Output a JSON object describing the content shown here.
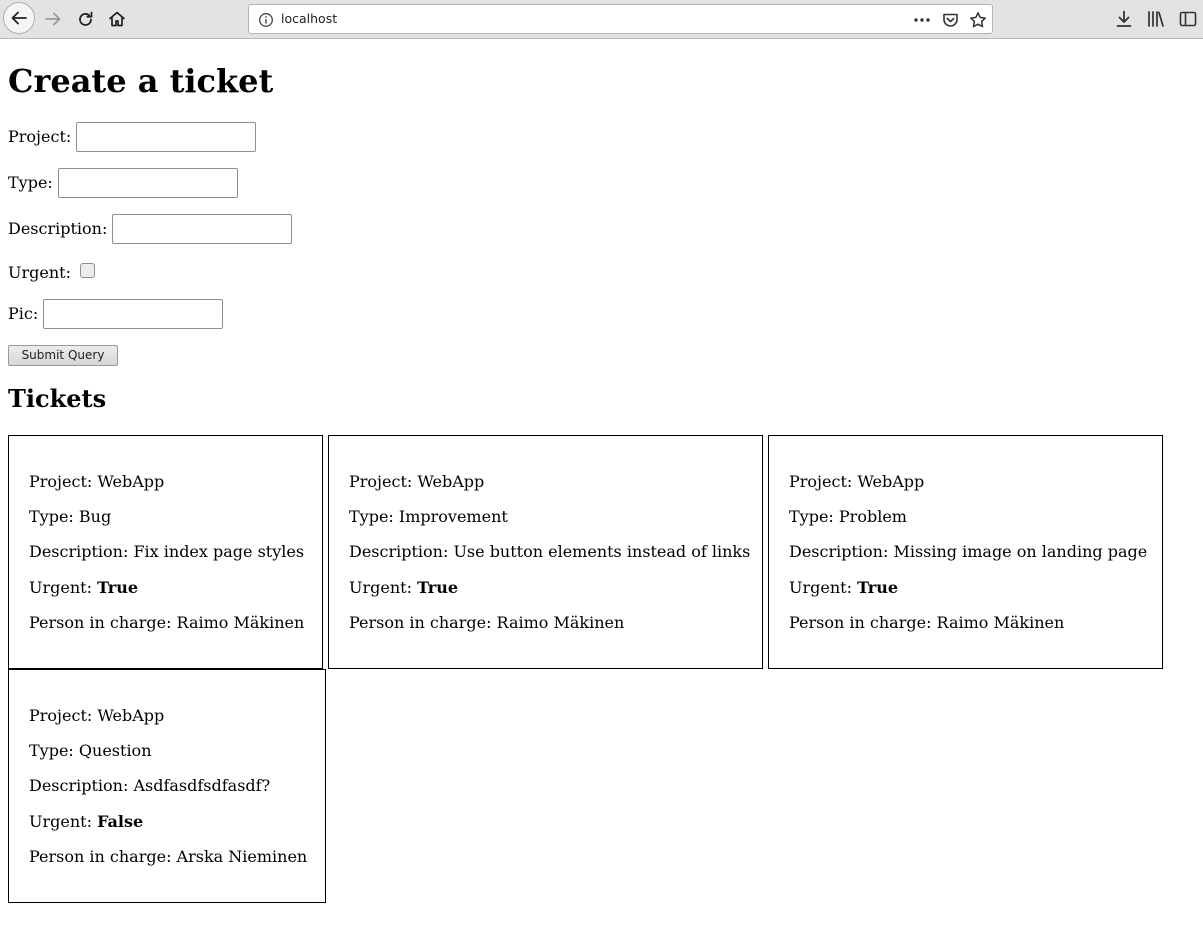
{
  "browser": {
    "url": "localhost",
    "buttons": {
      "back": "back-arrow-icon",
      "forward": "forward-arrow-icon",
      "reload": "reload-icon",
      "home": "home-icon",
      "page_actions": "more-icon",
      "pocket": "pocket-icon",
      "bookmark": "star-icon",
      "downloads": "download-icon",
      "library": "library-icon",
      "sidebar": "sidebar-icon"
    }
  },
  "form": {
    "title": "Create a ticket",
    "fields": {
      "project": {
        "label": "Project:",
        "value": ""
      },
      "type": {
        "label": "Type:",
        "value": ""
      },
      "description": {
        "label": "Description:",
        "value": ""
      },
      "urgent": {
        "label": "Urgent:",
        "checked": false
      },
      "pic": {
        "label": "Pic:",
        "value": ""
      }
    },
    "submit_label": "Submit Query"
  },
  "tickets_title": "Tickets",
  "labels": {
    "project": "Project: ",
    "type": "Type: ",
    "description": "Description: ",
    "urgent": "Urgent: ",
    "person": "Person in charge: "
  },
  "tickets": [
    {
      "project": "WebApp",
      "type": "Bug",
      "description": "Fix index page styles",
      "urgent": "True",
      "person": "Raimo Mäkinen"
    },
    {
      "project": "WebApp",
      "type": "Improvement",
      "description": "Use button elements instead of links",
      "urgent": "True",
      "person": "Raimo Mäkinen"
    },
    {
      "project": "WebApp",
      "type": "Problem",
      "description": "Missing image on landing page",
      "urgent": "True",
      "person": "Raimo Mäkinen"
    },
    {
      "project": "WebApp",
      "type": "Question",
      "description": "Asdfasdfsdfasdf?",
      "urgent": "False",
      "person": "Arska Nieminen"
    }
  ]
}
